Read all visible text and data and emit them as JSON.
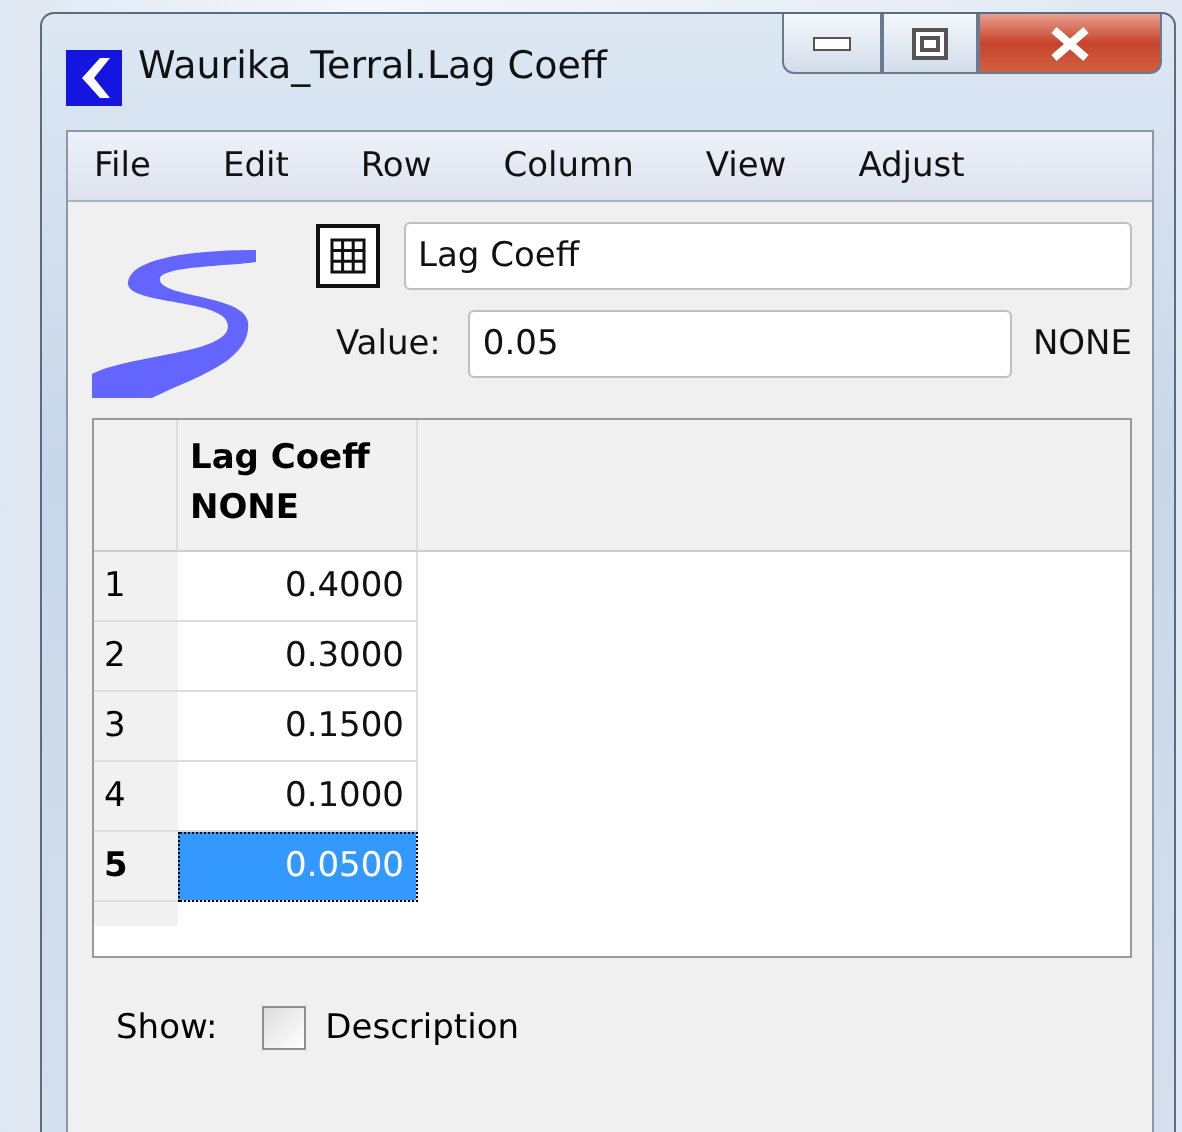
{
  "window": {
    "title": "Waurika_Terral.Lag Coeff"
  },
  "menu": [
    "File",
    "Edit",
    "Row",
    "Column",
    "View",
    "Adjust"
  ],
  "name_field": {
    "value": "Lag Coeff"
  },
  "value_field": {
    "label": "Value:",
    "value": "0.05",
    "unit": "NONE"
  },
  "table": {
    "columns": [
      {
        "title": "Lag Coeff",
        "unit": "NONE"
      }
    ],
    "rows": [
      {
        "index": "1",
        "value": "0.4000",
        "selected": false
      },
      {
        "index": "2",
        "value": "0.3000",
        "selected": false
      },
      {
        "index": "3",
        "value": "0.1500",
        "selected": false
      },
      {
        "index": "4",
        "value": "0.1000",
        "selected": false
      },
      {
        "index": "5",
        "value": "0.0500",
        "selected": true
      }
    ]
  },
  "show": {
    "label": "Show:",
    "option": "Description",
    "checked": false
  }
}
